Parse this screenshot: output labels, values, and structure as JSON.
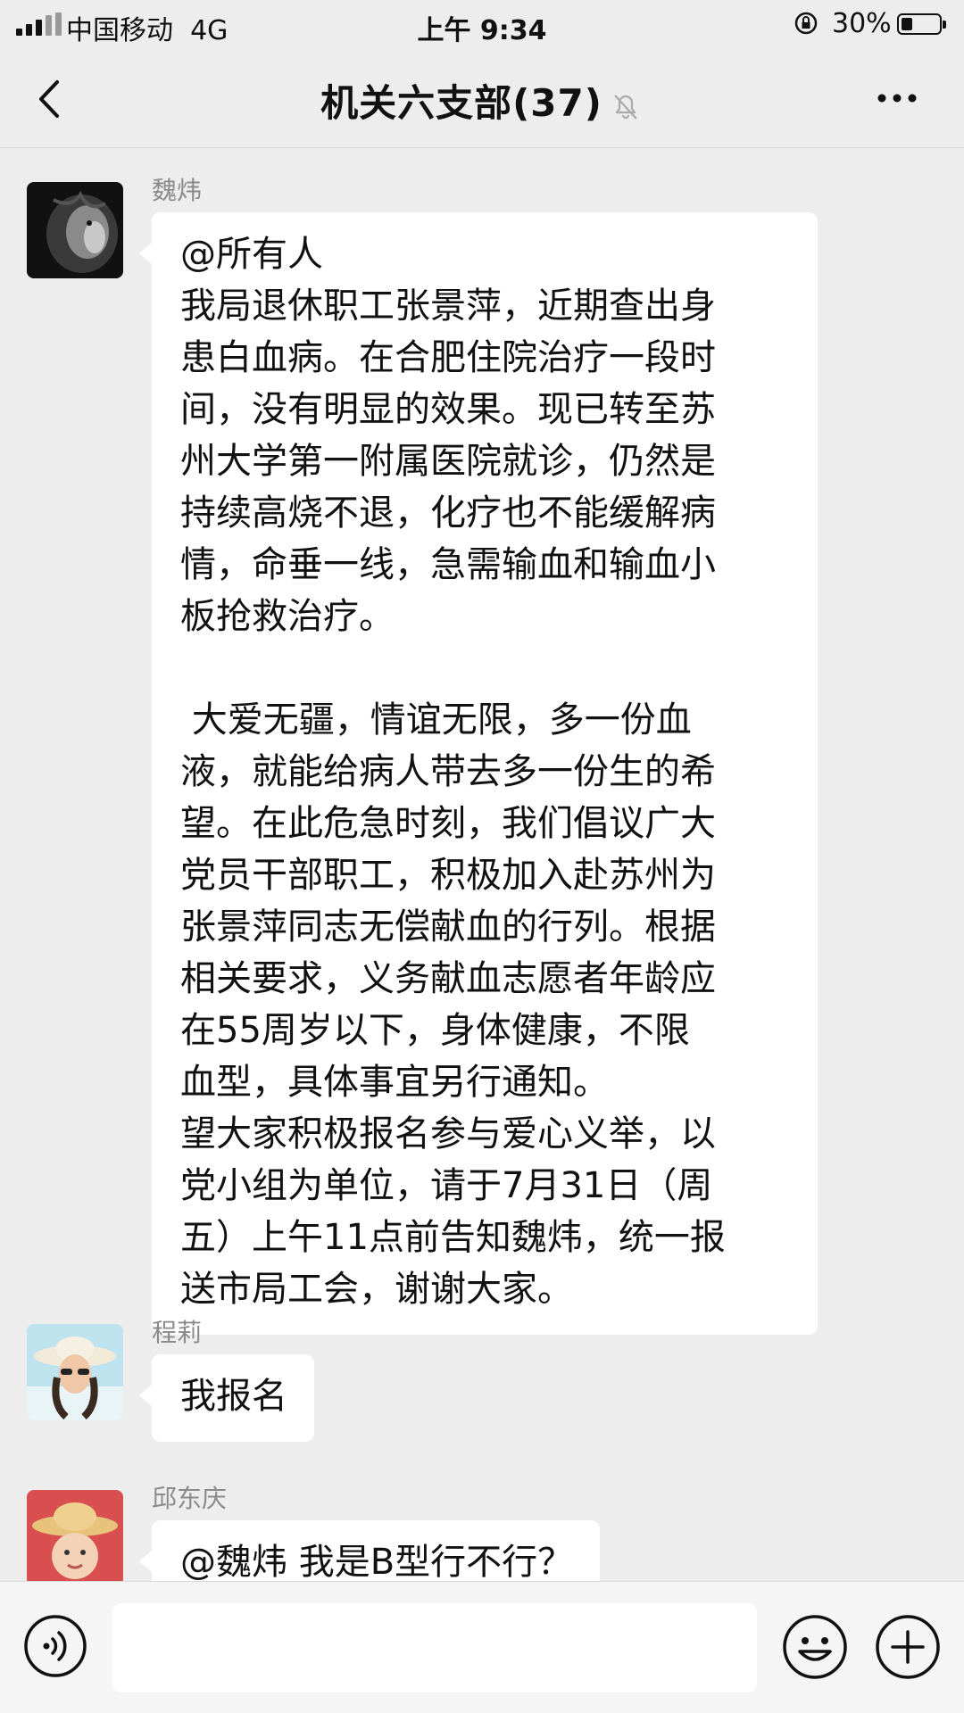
{
  "status_bar": {
    "carrier": "中国移动",
    "network": "4G",
    "time": "上午 9:34",
    "battery": "30%",
    "battery_level": 0.3
  },
  "header": {
    "title": "机关六支部(37)",
    "back_icon": "back-arrow-icon",
    "mute_icon": "muted-bell-icon",
    "more_icon": "more-dots-icon"
  },
  "messages": [
    {
      "sender": "魏炜",
      "avatar": "lion-avatar",
      "lines": [
        "@所有人",
        "我局退休职工张景萍，近期查出身",
        "患白血病。在合肥住院治疗一段时",
        "间，没有明显的效果。现已转至苏",
        "州大学第一附属医院就诊，仍然是",
        "持续高烧不退，化疗也不能缓解病",
        "情，命垂一线，急需输血和输血小",
        "板抢救治疗。",
        "",
        " 大爱无疆，情谊无限，多一份血",
        "液，就能给病人带去多一份生的希",
        "望。在此危急时刻，我们倡议广大",
        "党员干部职工，积极加入赴苏州为",
        "张景萍同志无偿献血的行列。根据",
        "相关要求，义务献血志愿者年龄应",
        "在55周岁以下，身体健康，不限",
        "血型，具体事宜另行通知。",
        "望大家积极报名参与爱心义举，以",
        "党小组为单位，请于7月31日（周",
        "五）上午11点前告知魏炜，统一报",
        "送市局工会，谢谢大家。"
      ]
    },
    {
      "sender": "程莉",
      "avatar": "woman-sunhat-avatar",
      "text": "我报名"
    },
    {
      "sender": "邱东庆",
      "avatar": "child-strawhat-avatar",
      "text": "@魏炜 我是B型行不行？"
    }
  ],
  "input_bar": {
    "voice_icon": "voice-icon",
    "input_value": "",
    "emoji_icon": "emoji-icon",
    "plus_icon": "plus-icon"
  }
}
